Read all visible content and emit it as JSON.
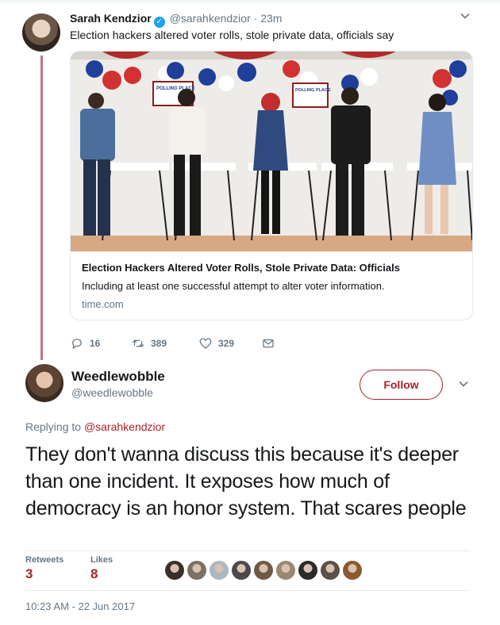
{
  "parent": {
    "name": "Sarah Kendzior",
    "handle": "@sarahkendzior",
    "dot": "·",
    "time": "23m",
    "text": "Election hackers altered voter rolls, stole private data, officials say",
    "card": {
      "title": "Election Hackers Altered Voter Rolls, Stole Private Data: Officials",
      "description": "Including at least one successful attempt to alter voter information.",
      "domain": "time.com",
      "sign_text": "POLLING PLACE"
    },
    "counts": {
      "replies": "16",
      "retweets": "389",
      "likes": "329"
    }
  },
  "focal": {
    "name": "Weedlewobble",
    "handle": "@weedlewobble",
    "follow_label": "Follow",
    "replying_prefix": "Replying to",
    "replying_mention": "@sarahkendzior",
    "text": "They don't wanna discuss this because it's deeper than one incident. It exposes how much of democracy is an honor system. That scares people",
    "stats": {
      "retweets_label": "Retweets",
      "retweets": "3",
      "likes_label": "Likes",
      "likes": "8"
    },
    "liker_colors": [
      "#3b2f2a",
      "#7c6f64",
      "#aab8c2",
      "#4a4a4a",
      "#6d5a45",
      "#9c8872",
      "#2b2b2b",
      "#5b5048",
      "#8a5a2e"
    ],
    "timestamp": "10:23 AM - 22 Jun 2017"
  },
  "colors": {
    "accent": "#a9212b",
    "thread_line": "#c3747e",
    "secondary_text": "#657786",
    "verified": "#1da1f2"
  },
  "icons": [
    "verified-icon",
    "chevron-down-icon",
    "reply-icon",
    "retweet-icon",
    "heart-icon",
    "envelope-icon"
  ]
}
